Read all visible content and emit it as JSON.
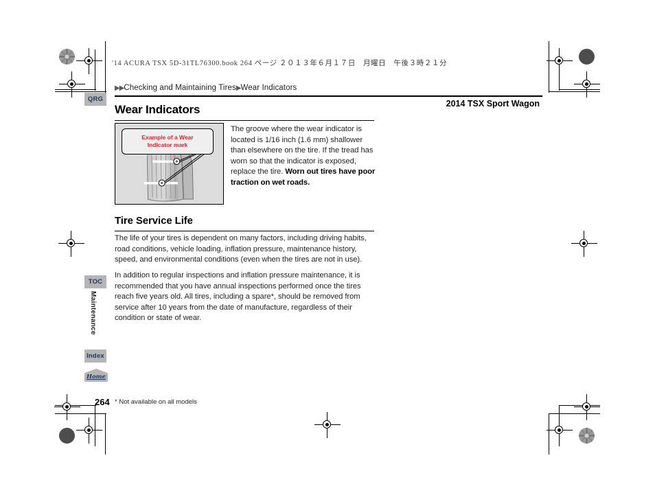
{
  "page": {
    "book_header": "'14 ACURA TSX 5D-31TL76300.book  264 ページ  ２０１３年６月１７日　月曜日　午後３時２１分",
    "model_name": "2014 TSX Sport Wagon",
    "page_number": "264",
    "footnote": "* Not available on all models"
  },
  "breadcrumb": {
    "arrow_1": "▶▶",
    "parent": "Checking and Maintaining Tires",
    "arrow_2": "▶",
    "current": "Wear Indicators"
  },
  "sections": {
    "wear_indicators": {
      "title": "Wear Indicators",
      "figure": {
        "callout_line_1": "Example of a Wear",
        "callout_line_2": "Indicator mark",
        "callout_color": "#ee1c25",
        "alt": "Illustration of a tire tread showing two wear indicator marks"
      },
      "body_plain": "The groove where the wear indicator is located is 1/16 inch (1.6 mm) shallower than elsewhere on the tire. If the tread has worn so that the indicator is exposed, replace the tire. ",
      "body_bold": "Worn out tires have poor traction on wet roads."
    },
    "tire_service_life": {
      "title": "Tire Service Life",
      "paragraph_1": "The life of your tires is dependent on many factors, including driving habits, road conditions, vehicle loading, inflation pressure, maintenance history, speed, and environmental conditions (even when the tires are not in use).",
      "paragraph_2": "In addition to regular inspections and inflation pressure maintenance, it is recommended that you have annual inspections performed once the tires reach five years old. All tires, including a spare*, should be removed from service after 10 years from the date of manufacture, regardless of their condition or state of wear."
    }
  },
  "side_tabs": {
    "qrg": "QRG",
    "toc": "TOC",
    "index": "Index",
    "home": "Home",
    "chapter": "Maintenance"
  },
  "colors": {
    "tab_background": "#b5b5b5",
    "tab_text": "#1f3864",
    "callout_red": "#ee1c25",
    "figure_background": "#dcdcdc",
    "body_text": "#231f20"
  }
}
